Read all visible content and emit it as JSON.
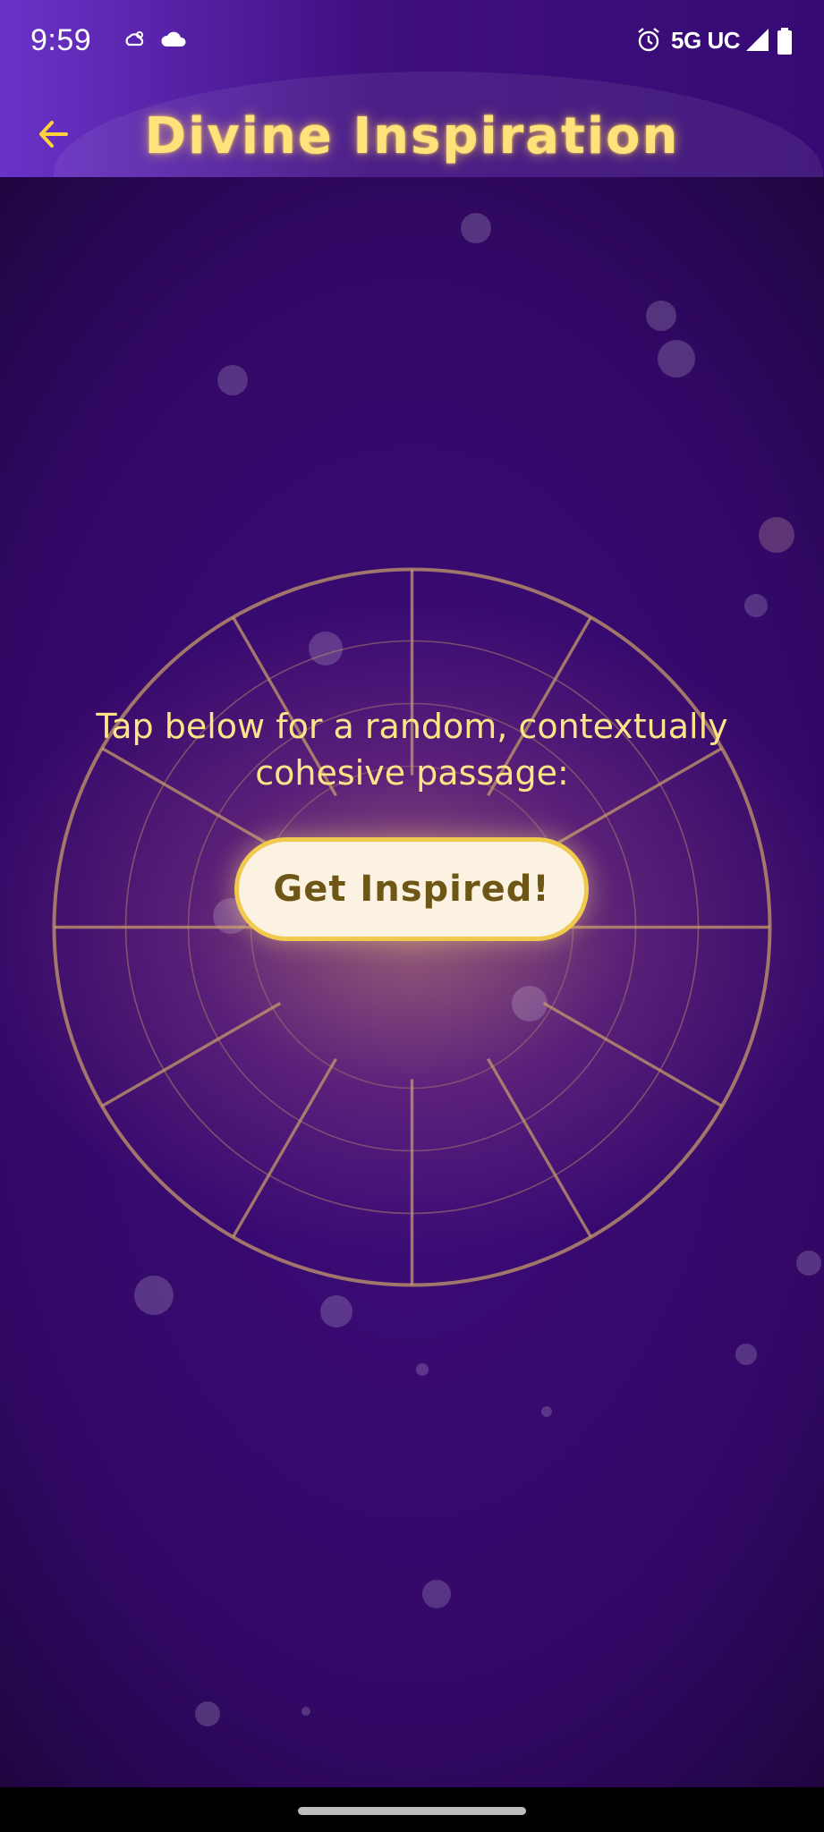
{
  "status_bar": {
    "time": "9:59",
    "network": "5G UC",
    "icons": [
      "weather-cloud-icon",
      "cloud-icon",
      "alarm-icon",
      "signal-icon",
      "battery-icon"
    ]
  },
  "app_bar": {
    "title": "Divine Inspiration",
    "back_icon": "arrow-left-icon",
    "accent_color": "#ffe27a"
  },
  "main": {
    "prompt": "Tap below for a random, contextually cohesive passage:",
    "button_label": "Get Inspired!"
  },
  "colors": {
    "background": "#320866",
    "button_bg": "#fbf2e2",
    "button_border": "#f1c94d",
    "button_text": "#6e5716",
    "wheel_line": "#c49a6a"
  }
}
